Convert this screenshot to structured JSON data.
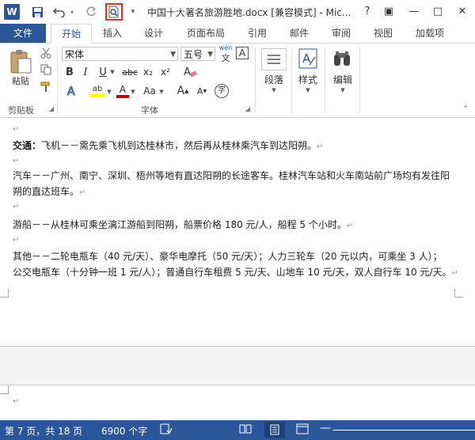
{
  "title_bar": {
    "app_icon_letter": "W",
    "title": "中国十大著名旅游胜地.docx [兼容模式] - Mic...",
    "help": "?",
    "restore": "▣",
    "minimize": "—",
    "maximize": "□",
    "close": "✕"
  },
  "tabs": {
    "file": "文件",
    "items": [
      "开始",
      "插入",
      "设计",
      "页面布局",
      "引用",
      "邮件",
      "审阅",
      "视图",
      "加载项"
    ]
  },
  "ribbon": {
    "clipboard": {
      "paste_label": "粘贴",
      "group_label": "剪贴板"
    },
    "font": {
      "font_name": "宋体",
      "font_size": "五号",
      "wen_label": "wén",
      "a_box": "A",
      "bold": "B",
      "italic": "I",
      "underline": "U",
      "strike": "abc",
      "subscript": "x₂",
      "superscript": "x²",
      "clear": "A",
      "highlight": "ab",
      "font_color": "A",
      "change_case": "Aa",
      "grow": "A",
      "shrink": "A",
      "circled": "字",
      "group_label": "字体"
    },
    "paragraph": {
      "label": "段落"
    },
    "styles": {
      "label": "样式"
    },
    "editing": {
      "label": "编辑"
    }
  },
  "document": {
    "lines": [
      {
        "bold": "",
        "text": ""
      },
      {
        "bold": "交通：",
        "text": "飞机－－需先乘飞机到达桂林市，然后再从桂林乘汽车到达阳朔。"
      },
      {
        "bold": "",
        "text": ""
      },
      {
        "bold": "",
        "text": "汽车－－广州、南宁、深圳、梧州等地有直达阳朔的长途客车。桂林汽车站和火车南站前广场均有发往阳"
      },
      {
        "bold": "",
        "text": "朔的直达班车。"
      },
      {
        "bold": "",
        "text": ""
      },
      {
        "bold": "",
        "text": "游船－－从桂林可乘坐漓江游船到阳朔，船票价格 180 元/人，船程 5 个小时。"
      },
      {
        "bold": "",
        "text": ""
      },
      {
        "bold": "",
        "text": "其他－－二轮电瓶车（40 元/天）、豪华电摩托（50 元/天）；人力三轮车（20 元以内，可乘坐 3 人）；"
      },
      {
        "bold": "",
        "text": "公交电瓶车（十分钟一班 1 元/人）；普通自行车租费 5 元/天、山地车 10 元/天，双人自行车 10 元/天。"
      }
    ],
    "page2_first_line": ""
  },
  "status_bar": {
    "page": "第 7 页，共 18 页",
    "words": "6900 个字"
  },
  "colors": {
    "accent": "#2b579a",
    "highlight": "#ffff00",
    "font_red": "#d00000",
    "focus_red": "#d9342b"
  }
}
